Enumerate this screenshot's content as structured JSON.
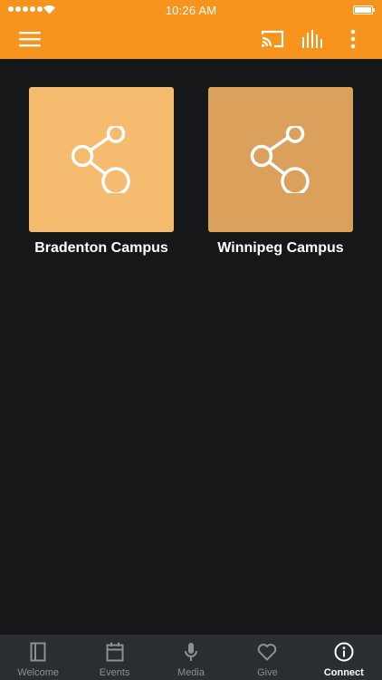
{
  "colors": {
    "accent": "#f7941d",
    "background": "#151719",
    "tabbar": "#2b2e31",
    "tile_bradenton": "#f5bb6e",
    "tile_winnipeg": "#dba05b"
  },
  "status_bar": {
    "time": "10:26 AM",
    "signal_dots": 5
  },
  "app_bar": {
    "icons": [
      "menu-icon",
      "cast-icon",
      "equalizer-icon",
      "more-vertical-icon"
    ]
  },
  "grid": {
    "items": [
      {
        "label": "Bradenton Campus",
        "icon": "share-icon"
      },
      {
        "label": "Winnipeg Campus",
        "icon": "share-icon"
      }
    ]
  },
  "tabs": {
    "items": [
      {
        "label": "Welcome",
        "icon": "book-icon",
        "active": false
      },
      {
        "label": "Events",
        "icon": "calendar-icon",
        "active": false
      },
      {
        "label": "Media",
        "icon": "microphone-icon",
        "active": false
      },
      {
        "label": "Give",
        "icon": "heart-icon",
        "active": false
      },
      {
        "label": "Connect",
        "icon": "info-icon",
        "active": true
      }
    ]
  }
}
